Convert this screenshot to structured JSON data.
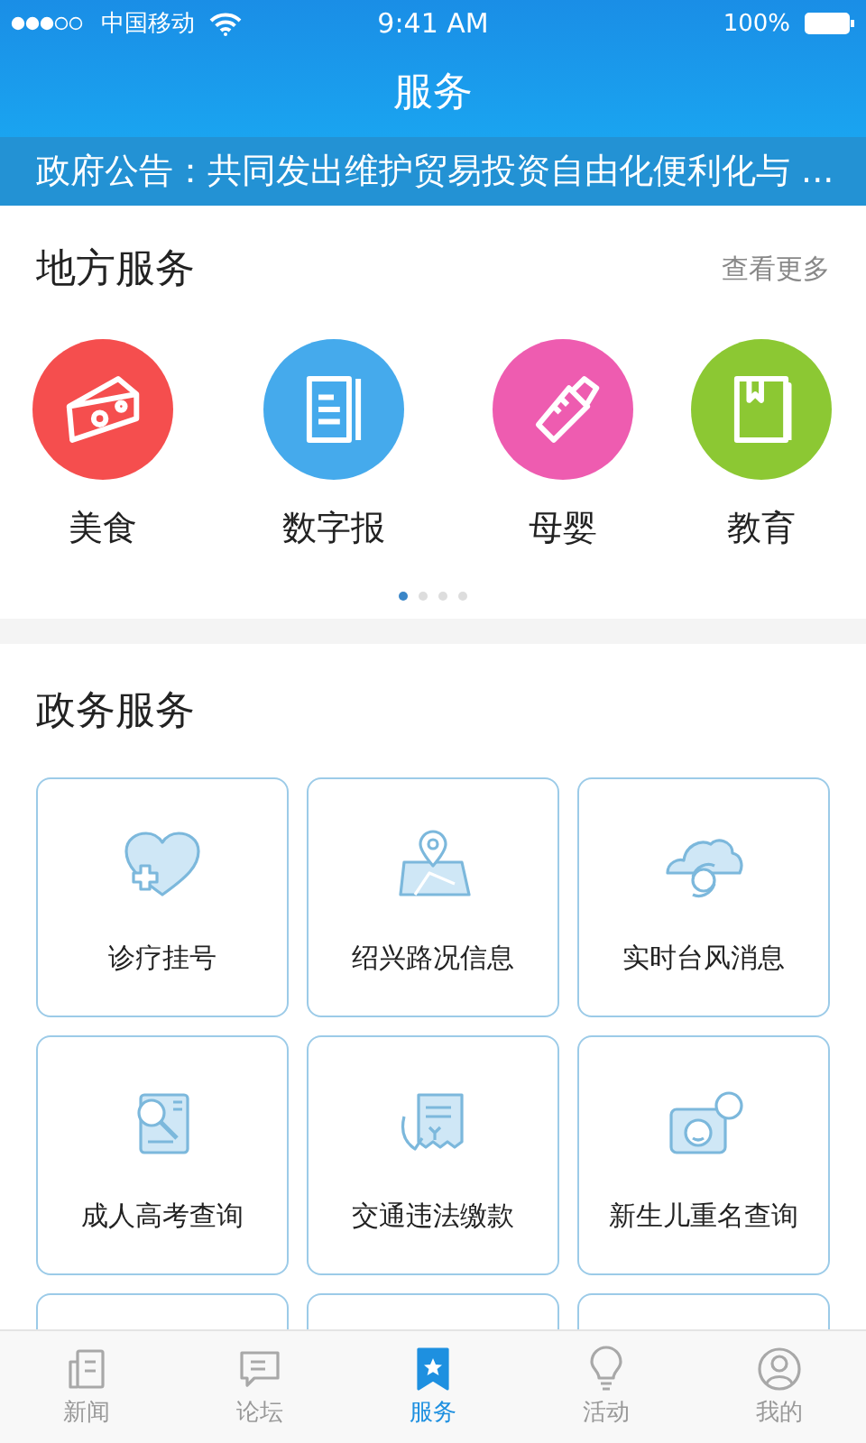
{
  "status_bar": {
    "carrier": "中国移动",
    "time": "9:41 AM",
    "battery": "100%"
  },
  "header": {
    "title": "服务"
  },
  "notice": {
    "text": "政府公告：共同发出维护贸易投资自由化便利化与 ..."
  },
  "local_services": {
    "title": "地方服务",
    "more": "查看更多",
    "items": [
      {
        "label": "美食",
        "kind": "cheese",
        "color": "#f54e4e"
      },
      {
        "label": "数字报",
        "kind": "newspaper",
        "color": "#45aaec"
      },
      {
        "label": "母婴",
        "kind": "bottle",
        "color": "#ee5cb0"
      },
      {
        "label": "教育",
        "kind": "book",
        "color": "#8cc833"
      }
    ],
    "pages": [
      {
        "selected": true
      },
      {
        "selected": false
      },
      {
        "selected": false
      },
      {
        "selected": false
      }
    ]
  },
  "gov_services": {
    "title": "政务服务",
    "items": [
      {
        "label": "诊疗挂号",
        "kind": "heart"
      },
      {
        "label": "绍兴路况信息",
        "kind": "map"
      },
      {
        "label": "实时台风消息",
        "kind": "typhoon"
      },
      {
        "label": "成人高考查询",
        "kind": "document"
      },
      {
        "label": "交通违法缴款",
        "kind": "receipt"
      },
      {
        "label": "新生儿重名查询",
        "kind": "baby"
      }
    ]
  },
  "tab_bar": [
    {
      "label": "新闻",
      "kind": "news",
      "selected": false
    },
    {
      "label": "论坛",
      "kind": "forum",
      "selected": false
    },
    {
      "label": "服务",
      "kind": "service",
      "selected": true
    },
    {
      "label": "活动",
      "kind": "bulb",
      "selected": false
    },
    {
      "label": "我的",
      "kind": "user",
      "selected": false
    }
  ]
}
